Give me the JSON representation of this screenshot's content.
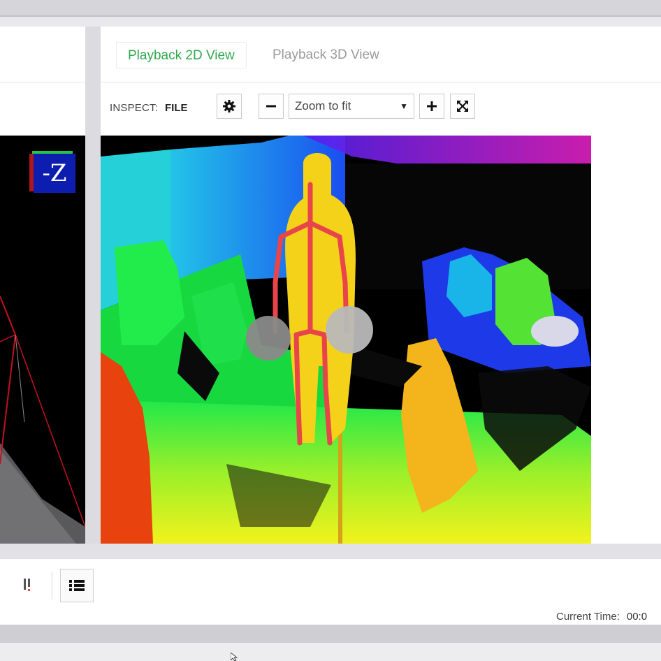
{
  "tabs": [
    {
      "label": "Playback 2D View",
      "active": true
    },
    {
      "label": "Playback 3D View",
      "active": false
    }
  ],
  "toolbar": {
    "inspect_label": "INSPECT:",
    "inspect_value": "FILE",
    "zoom_value": "Zoom to fit"
  },
  "axis_indicator": {
    "label": "-Z"
  },
  "status": {
    "current_time_label": "Current Time:",
    "current_time_value": "00:0"
  },
  "icons": [
    "gear-icon",
    "minus-icon",
    "plus-icon",
    "fit-screen-icon",
    "chevron-down-icon",
    "marker-icon",
    "list-icon"
  ],
  "colors": {
    "accent": "#2fa84c",
    "skeleton": "#e8454a",
    "axis_face": "#0d1db0"
  }
}
